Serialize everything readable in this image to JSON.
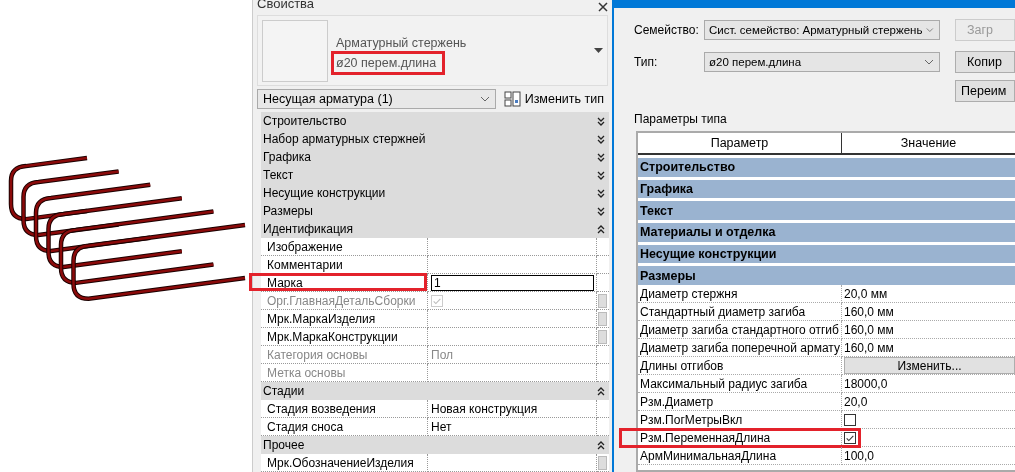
{
  "properties": {
    "title": "Свойства",
    "type_selector": {
      "family": "Арматурный стержень",
      "type": "ø20 перем.длина",
      "highlighted": true
    },
    "filter": "Несущая арматура (1)",
    "edit_type_button": "Изменить тип",
    "rows": [
      {
        "kind": "group",
        "label": "Строительство",
        "expanded": false
      },
      {
        "kind": "group",
        "label": "Набор арматурных стержней",
        "expanded": false
      },
      {
        "kind": "group",
        "label": "Графика",
        "expanded": false
      },
      {
        "kind": "group",
        "label": "Текст",
        "expanded": false
      },
      {
        "kind": "group",
        "label": "Несущие конструкции",
        "expanded": false
      },
      {
        "kind": "group",
        "label": "Размеры",
        "expanded": false
      },
      {
        "kind": "group",
        "label": "Идентификация",
        "expanded": true
      },
      {
        "kind": "text",
        "label": "Изображение",
        "disabled": false,
        "associate": false,
        "highlighted": false
      },
      {
        "kind": "text",
        "label": "Комментарии",
        "disabled": false,
        "associate": false,
        "highlighted": false
      },
      {
        "kind": "input",
        "label": "Марка",
        "value": "1",
        "disabled": false,
        "associate": false,
        "highlighted": true
      },
      {
        "kind": "checkbox",
        "label": "Орг.ГлавнаяДетальСборки",
        "checked": true,
        "disabled": true,
        "associate": true,
        "highlighted": false
      },
      {
        "kind": "text",
        "label": "Мрк.МаркаИзделия",
        "disabled": false,
        "associate": true,
        "highlighted": false
      },
      {
        "kind": "text",
        "label": "Мрк.МаркаКонструкции",
        "disabled": false,
        "associate": true,
        "highlighted": false
      },
      {
        "kind": "text",
        "label": "Категория основы",
        "value": "Пол",
        "disabled": true,
        "associate": false,
        "highlighted": false
      },
      {
        "kind": "text",
        "label": "Метка основы",
        "disabled": true,
        "associate": false,
        "highlighted": false
      },
      {
        "kind": "group",
        "label": "Стадии",
        "expanded": true
      },
      {
        "kind": "text",
        "label": "Стадия возведения",
        "value": "Новая конструкция",
        "disabled": false,
        "associate": false,
        "highlighted": false
      },
      {
        "kind": "text",
        "label": "Стадия сноса",
        "value": "Нет",
        "disabled": false,
        "associate": false,
        "highlighted": false
      },
      {
        "kind": "group",
        "label": "Прочее",
        "expanded": true
      },
      {
        "kind": "text",
        "label": "Мрк.ОбозначениеИзделия",
        "disabled": false,
        "associate": true,
        "highlighted": false
      }
    ]
  },
  "type_dialog": {
    "family_label": "Семейство:",
    "family": "Сист. семейство: Арматурный стержень",
    "load_button": {
      "label": "Загр",
      "disabled": true
    },
    "type_label": "Тип:",
    "type": "ø20 перем.длина",
    "duplicate_button": {
      "label": "Копир",
      "disabled": false
    },
    "rename_button": {
      "label": "Переим",
      "disabled": false
    },
    "section_label": "Параметры типа",
    "columns": [
      "Параметр",
      "Значение"
    ],
    "rows": [
      {
        "kind": "group",
        "label": "Строительство"
      },
      {
        "kind": "group",
        "label": "Графика"
      },
      {
        "kind": "group",
        "label": "Текст"
      },
      {
        "kind": "group",
        "label": "Материалы и отделка"
      },
      {
        "kind": "group",
        "label": "Несущие конструкции"
      },
      {
        "kind": "group",
        "label": "Размеры"
      },
      {
        "kind": "text",
        "label": "Диаметр стержня",
        "value": "20,0 мм",
        "highlighted": false
      },
      {
        "kind": "text",
        "label": "Стандартный диаметр загиба",
        "value": "160,0 мм",
        "highlighted": false
      },
      {
        "kind": "text",
        "label": "Диаметр загиба стандартного отгиб",
        "value": "160,0 мм",
        "highlighted": false
      },
      {
        "kind": "text",
        "label": "Диаметр загиба поперечной армату",
        "value": "160,0 мм",
        "highlighted": false
      },
      {
        "kind": "button",
        "label": "Длины отгибов",
        "value": "Изменить...",
        "highlighted": false
      },
      {
        "kind": "text",
        "label": "Максимальный радиус загиба",
        "value": "18000,0",
        "highlighted": false
      },
      {
        "kind": "text",
        "label": "Рзм.Диаметр",
        "value": "20,0",
        "highlighted": false
      },
      {
        "kind": "checkbox",
        "label": "Рзм.ПогМетрыВкл",
        "checked": false,
        "highlighted": false
      },
      {
        "kind": "checkbox",
        "label": "Рзм.ПеременнаяДлина",
        "checked": true,
        "highlighted": true
      },
      {
        "kind": "text",
        "label": "АрмМинимальнаяДлина",
        "value": "100,0",
        "highlighted": false
      }
    ]
  }
}
